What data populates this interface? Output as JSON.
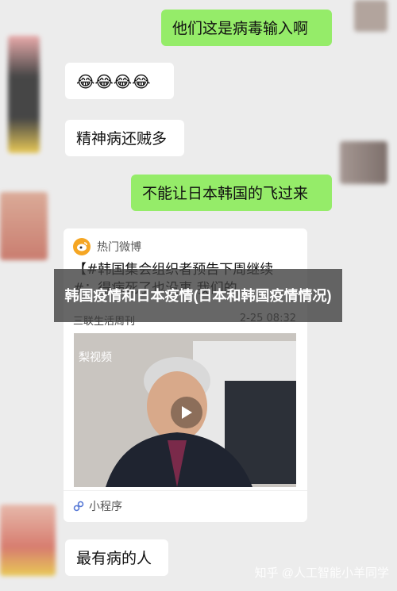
{
  "messages": [
    {
      "text": "他们这是病毒输入啊"
    },
    {
      "text": "😂😂😂😂"
    },
    {
      "text": "精神病还贼多"
    },
    {
      "text": "不能让日本韩国的飞过来"
    },
    {
      "text": "最有病的人"
    }
  ],
  "shared_card": {
    "source": "热门微博",
    "title": "【#韩国集会组织者预告下周继续#：得病死了也没事 我们的…",
    "author": "三联生活周刊",
    "time": "2-25 08:32",
    "video_label": "梨视频",
    "mini_program": "小程序"
  },
  "overlay_title": "韩国疫情和日本疫情(日本和韩国疫情情况)",
  "watermark": "知乎 @人工智能小羊同学",
  "colors": {
    "background": "#ececec",
    "sent_bubble": "#95ec69",
    "received_bubble": "#ffffff",
    "weibo_icon": "#f5a623"
  }
}
